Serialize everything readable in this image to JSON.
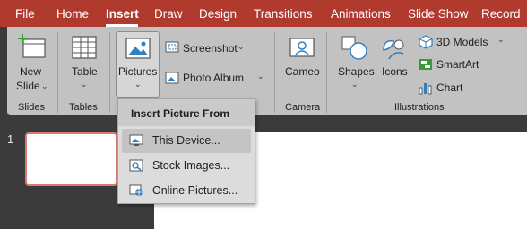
{
  "menu": {
    "tabs": [
      "File",
      "Home",
      "Insert",
      "Draw",
      "Design",
      "Transitions",
      "Animations",
      "Slide Show",
      "Record"
    ],
    "active": "Insert"
  },
  "ribbon": {
    "slides_group": {
      "new_slide_line1": "New",
      "new_slide_line2": "Slide",
      "label": "Slides"
    },
    "tables_group": {
      "table_label": "Table",
      "label": "Tables"
    },
    "images_group": {
      "pictures_label": "Pictures",
      "screenshot_label": "Screenshot",
      "photo_album_label": "Photo Album"
    },
    "camera_group": {
      "cameo_label": "Cameo",
      "label": "Camera"
    },
    "illustrations_group": {
      "shapes_label": "Shapes",
      "icons_label": "Icons",
      "models_label": "3D Models",
      "smartart_label": "SmartArt",
      "chart_label": "Chart",
      "label": "Illustrations"
    }
  },
  "dropdown": {
    "header": "Insert Picture From",
    "items": [
      {
        "label": "This Device...",
        "icon": "device-picture-icon"
      },
      {
        "label": "Stock Images...",
        "icon": "stock-images-icon"
      },
      {
        "label": "Online Pictures...",
        "icon": "online-pictures-icon"
      }
    ]
  },
  "slides_pane": {
    "slide_number": "1"
  },
  "colors": {
    "accent": "#b03a2e",
    "ribbon": "#c2c2c2",
    "thumb_border": "#d87d6e"
  }
}
